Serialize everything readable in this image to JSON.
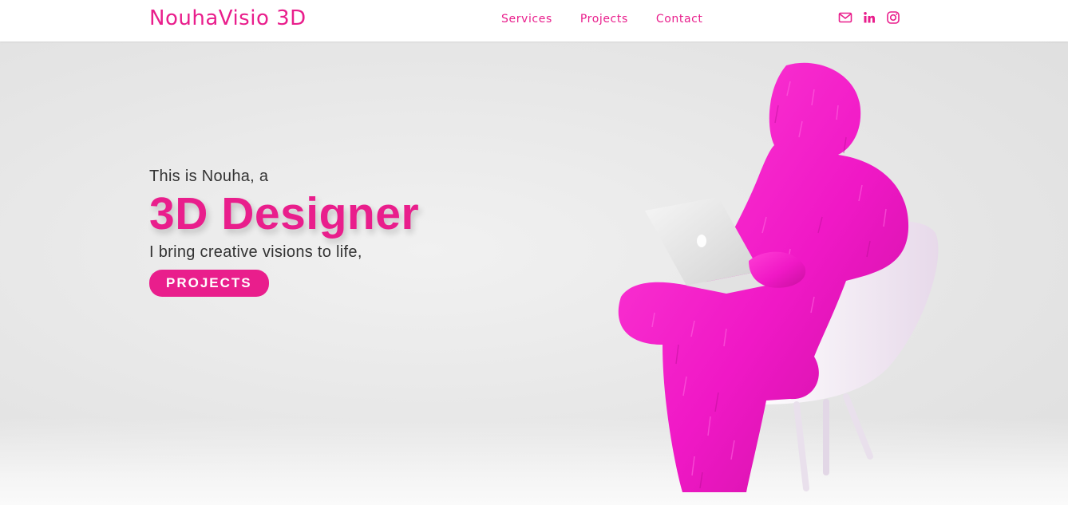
{
  "brand": {
    "name": "NouhaVisio 3D",
    "accent": "#e91e8c"
  },
  "nav": {
    "links": [
      "Services",
      "Projects",
      "Contact"
    ],
    "socials": [
      "mail-icon",
      "linkedin-icon",
      "instagram-icon"
    ]
  },
  "hero": {
    "intro": "This is Nouha, a",
    "title": "3D Designer",
    "tagline": "I bring creative visions to life,",
    "cta": "PROJECTS",
    "image": "pink-furry-figure-on-white-chair-with-laptop"
  }
}
